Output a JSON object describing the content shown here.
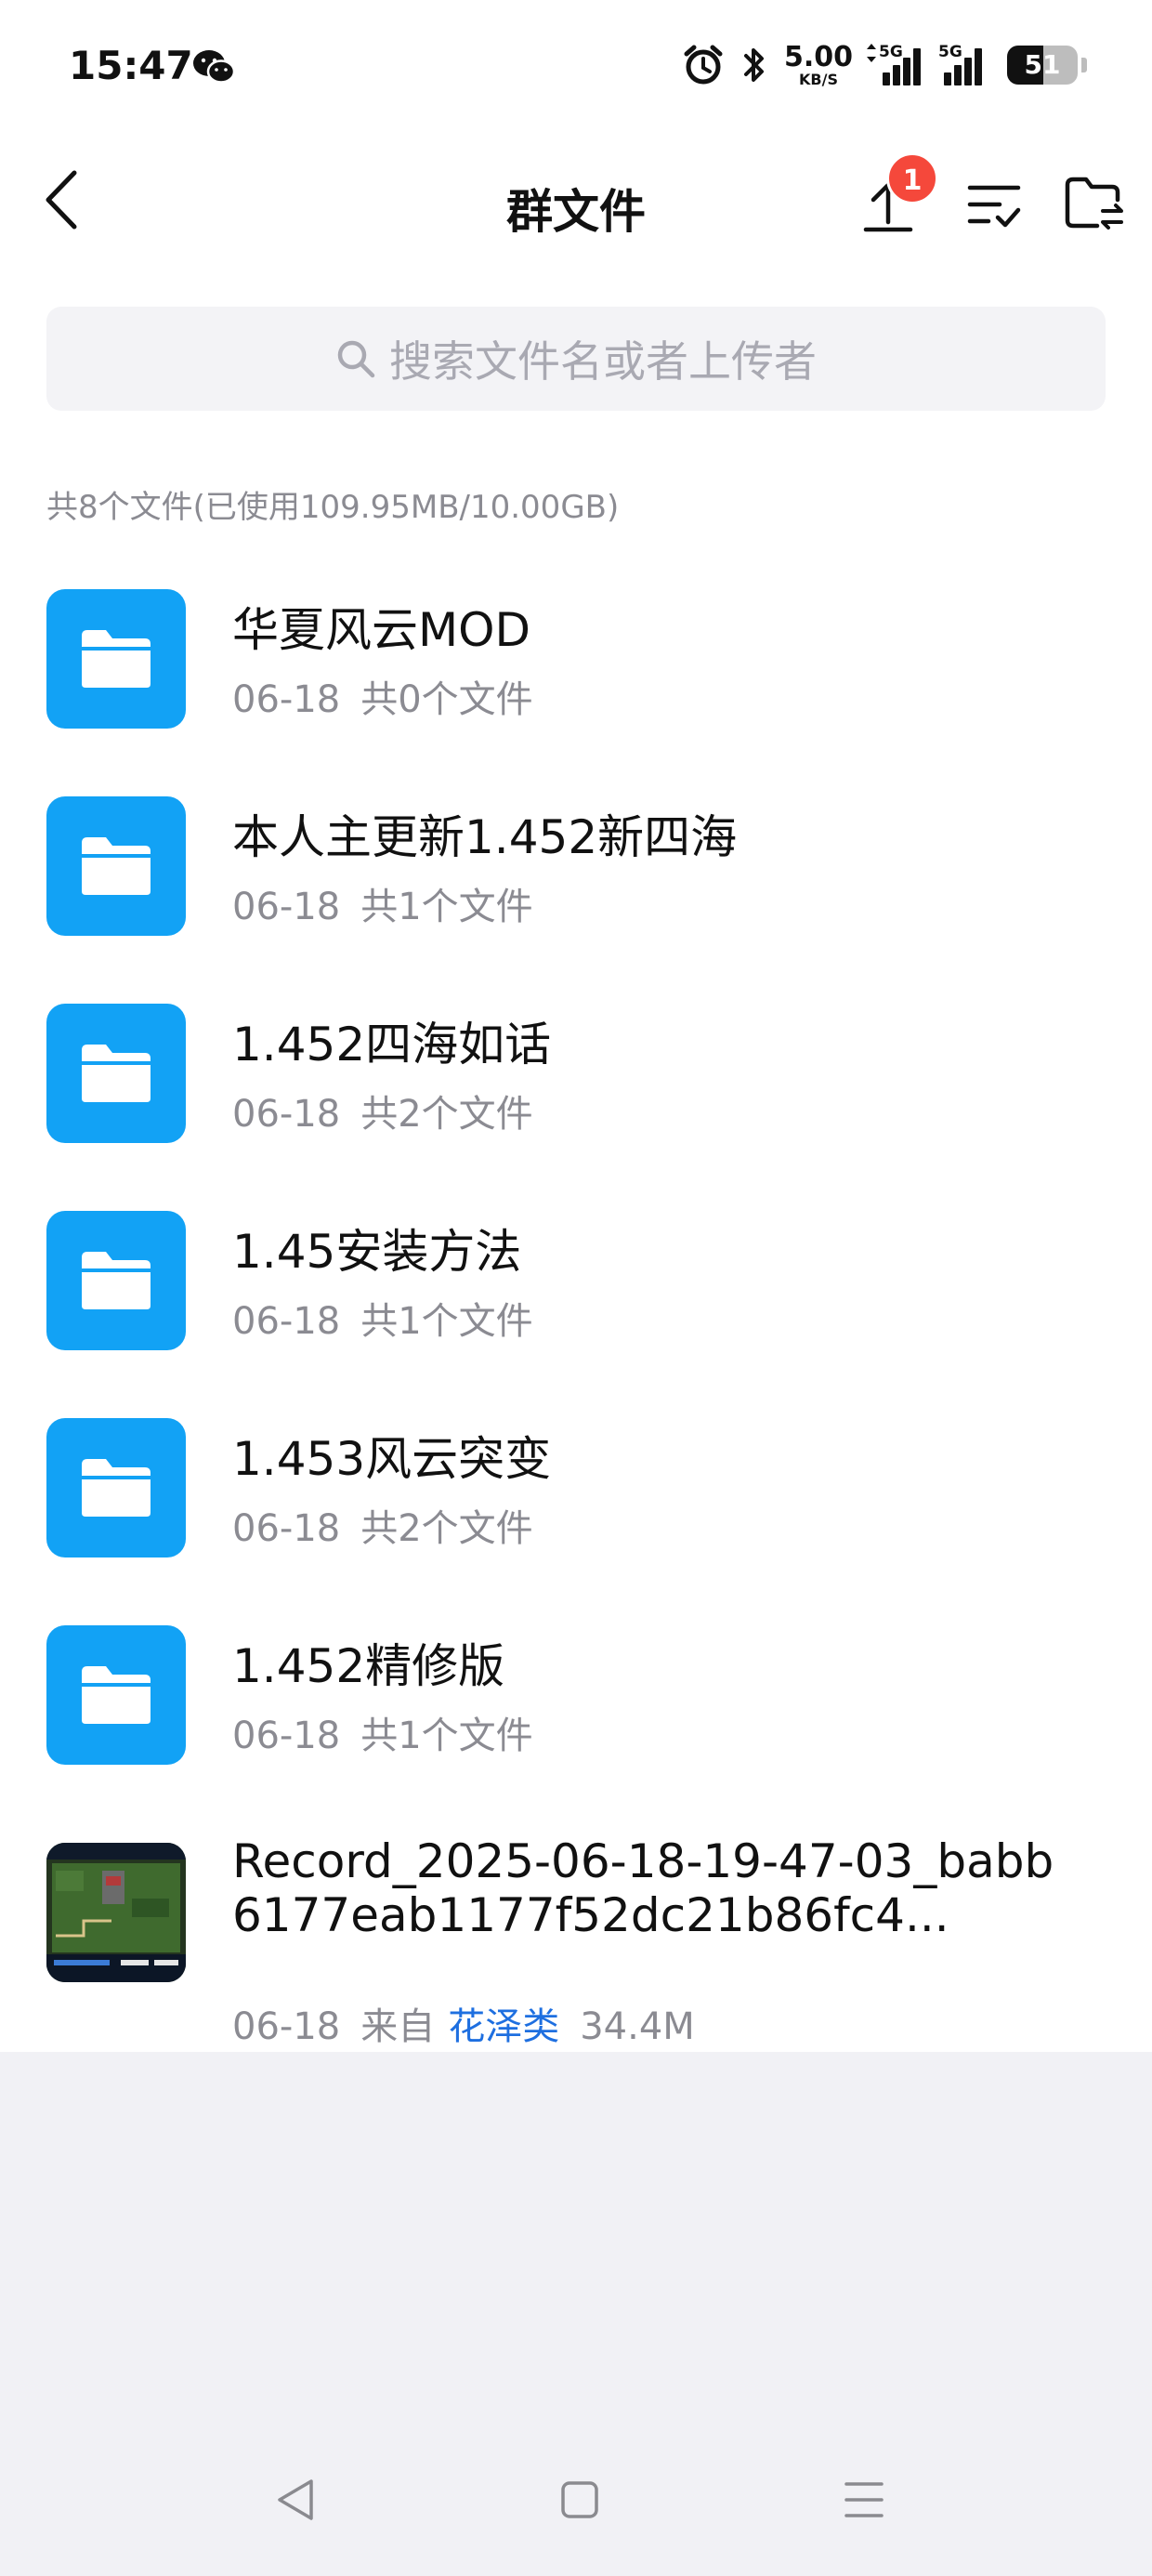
{
  "status_bar": {
    "time": "15:47",
    "net_speed_value": "5.00",
    "net_speed_unit": "KB/S",
    "signal1_label": "5G",
    "signal2_label": "5G",
    "battery_percent": "51",
    "icons": [
      "wechat-icon",
      "alarm-icon",
      "bluetooth-icon",
      "data-transfer-icon",
      "signal-icon",
      "battery-icon"
    ]
  },
  "header": {
    "title": "群文件",
    "upload_badge": "1",
    "icons": [
      "back-arrow-icon",
      "upload-icon",
      "sort-list-icon",
      "folder-switch-icon"
    ]
  },
  "search": {
    "placeholder": "搜索文件名或者上传者"
  },
  "summary": "共8个文件(已使用109.95MB/10.00GB)",
  "folders": [
    {
      "name": "华夏风云MOD",
      "date": "06-18",
      "count": "共0个文件"
    },
    {
      "name": "本人主更新1.452新四海",
      "date": "06-18",
      "count": "共1个文件"
    },
    {
      "name": "1.452四海如话",
      "date": "06-18",
      "count": "共2个文件"
    },
    {
      "name": "1.45安装方法",
      "date": "06-18",
      "count": "共1个文件"
    },
    {
      "name": "1.453风云突变",
      "date": "06-18",
      "count": "共2个文件"
    },
    {
      "name": "1.452精修版",
      "date": "06-18",
      "count": "共1个文件"
    }
  ],
  "record_file": {
    "name": "Record_2025-06-18-19-47-03_babb6177eab1177f52dc21b86fc4...",
    "date": "06-18",
    "from_label": "来自",
    "uploader": "花泽类",
    "size": "34.4M"
  },
  "nav": {
    "icons": [
      "nav-back-icon",
      "nav-home-icon",
      "nav-menu-icon"
    ]
  },
  "colors": {
    "folder_blue": "#12a2f5",
    "badge_red": "#f5483b",
    "uploader_link": "#1e6fe0",
    "secondary_text": "#8b8b92",
    "bottom_area": "#f1f1f5"
  }
}
